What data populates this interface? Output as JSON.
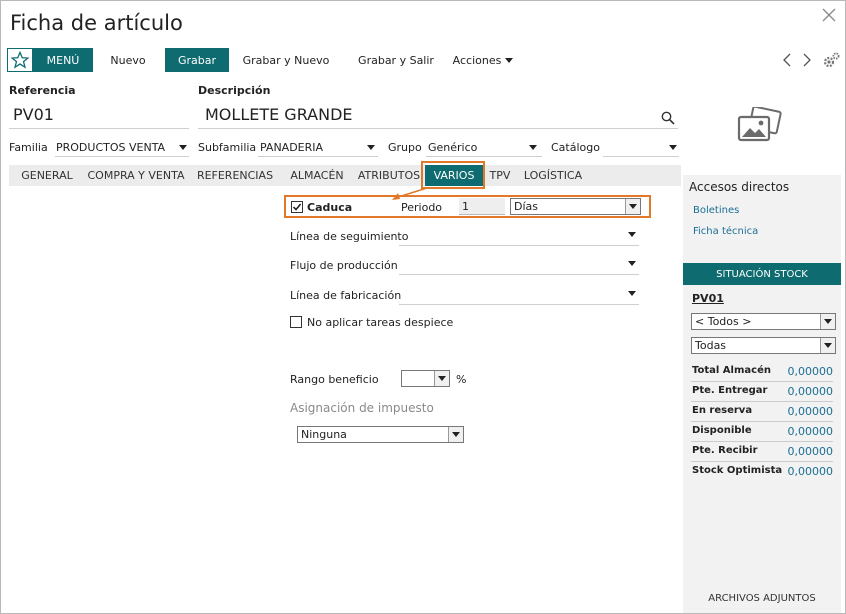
{
  "window": {
    "title": "Ficha de artículo"
  },
  "toolbar": {
    "menu_label": "MENÚ",
    "nuevo_label": "Nuevo",
    "grabar_label": "Grabar",
    "grabar_nuevo_label": "Grabar y Nuevo",
    "grabar_salir_label": "Grabar y Salir",
    "acciones_label": "Acciones"
  },
  "header": {
    "referencia_label": "Referencia",
    "referencia_value": "PV01",
    "descripcion_label": "Descripción",
    "descripcion_value": "MOLLETE GRANDE"
  },
  "combos": {
    "familia_label": "Familia",
    "familia_value": "PRODUCTOS VENTA",
    "subfamilia_label": "Subfamilia",
    "subfamilia_value": "PANADERIA",
    "grupo_label": "Grupo",
    "grupo_value": "Genérico",
    "catalogo_label": "Catálogo",
    "catalogo_value": ""
  },
  "tabs": [
    {
      "label": "GENERAL"
    },
    {
      "label": "COMPRA Y VENTA"
    },
    {
      "label": "REFERENCIAS"
    },
    {
      "label": "ALMACÉN"
    },
    {
      "label": "ATRIBUTOS"
    },
    {
      "label": "VARIOS"
    },
    {
      "label": "TPV"
    },
    {
      "label": "LOGÍSTICA"
    }
  ],
  "varios": {
    "caduca_label": "Caduca",
    "caduca_checked": true,
    "periodo_label": "Periodo",
    "periodo_value": "1",
    "periodo_unit": "Días",
    "linea_seguimiento_label": "Línea de seguimiento",
    "flujo_produccion_label": "Flujo de producción",
    "linea_fabricacion_label": "Línea de fabricación",
    "no_aplicar_label": "No aplicar tareas despiece",
    "rango_beneficio_label": "Rango beneficio",
    "rango_beneficio_unit": "%",
    "asignacion_label": "Asignación de impuesto",
    "asignacion_value": "Ninguna"
  },
  "sidebar": {
    "accesos_title": "Accesos directos",
    "links": [
      "Boletines",
      "Ficha técnica"
    ],
    "stock_title": "SITUACIÓN STOCK",
    "stock_ref": "PV01",
    "almacen_select": "< Todos >",
    "second_select": "Todas",
    "rows": [
      {
        "label": "Total Almacén",
        "value": "0,00000"
      },
      {
        "label": "Pte. Entregar",
        "value": "0,00000"
      },
      {
        "label": "En reserva",
        "value": "0,00000"
      },
      {
        "label": "Disponible",
        "value": "0,00000"
      },
      {
        "label": "Pte. Recibir",
        "value": "0,00000"
      },
      {
        "label": "Stock Optimista",
        "value": "0,00000"
      }
    ],
    "attachments_label": "ARCHIVOS ADJUNTOS"
  },
  "colors": {
    "accent": "#0e6b70",
    "highlight": "#e07a2a",
    "link": "#1a6f95"
  }
}
